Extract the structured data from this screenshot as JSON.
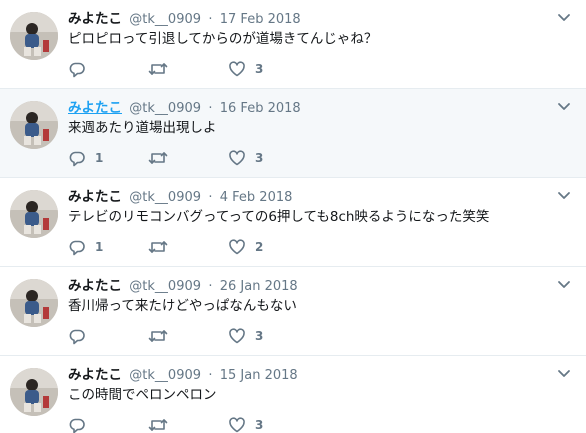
{
  "tweets": [
    {
      "name": "みよたこ",
      "handle": "@tk__0909",
      "separator": "·",
      "date": "17 Feb 2018",
      "text": "ピロピロって引退してからのが道場きてんじゃね？",
      "reply_count": "",
      "retweet_count": "",
      "like_count": "3",
      "hovered": false
    },
    {
      "name": "みよたこ",
      "handle": "@tk__0909",
      "separator": "·",
      "date": "16 Feb 2018",
      "text": "来週あたり道場出現しよ",
      "reply_count": "1",
      "retweet_count": "",
      "like_count": "3",
      "hovered": true
    },
    {
      "name": "みよたこ",
      "handle": "@tk__0909",
      "separator": "·",
      "date": "4 Feb 2018",
      "text": "テレビのリモコンバグってっての6押しても8ch映るようになった笑笑",
      "reply_count": "1",
      "retweet_count": "",
      "like_count": "2",
      "hovered": false
    },
    {
      "name": "みよたこ",
      "handle": "@tk__0909",
      "separator": "·",
      "date": "26 Jan 2018",
      "text": "香川帰って来たけどやっぱなんもない",
      "reply_count": "",
      "retweet_count": "",
      "like_count": "3",
      "hovered": false
    },
    {
      "name": "みよたこ",
      "handle": "@tk__0909",
      "separator": "·",
      "date": "15 Jan 2018",
      "text": "この時間でペロンペロン",
      "reply_count": "",
      "retweet_count": "",
      "like_count": "3",
      "hovered": false
    }
  ],
  "icons": {
    "reply": "reply-icon",
    "retweet": "retweet-icon",
    "like": "heart-icon",
    "more": "chevron-down-icon"
  },
  "colors": {
    "text": "#14171a",
    "secondary": "#657786",
    "link": "#1da1f2",
    "hover_bg": "#f5f8fa",
    "border": "#e6ecf0"
  }
}
